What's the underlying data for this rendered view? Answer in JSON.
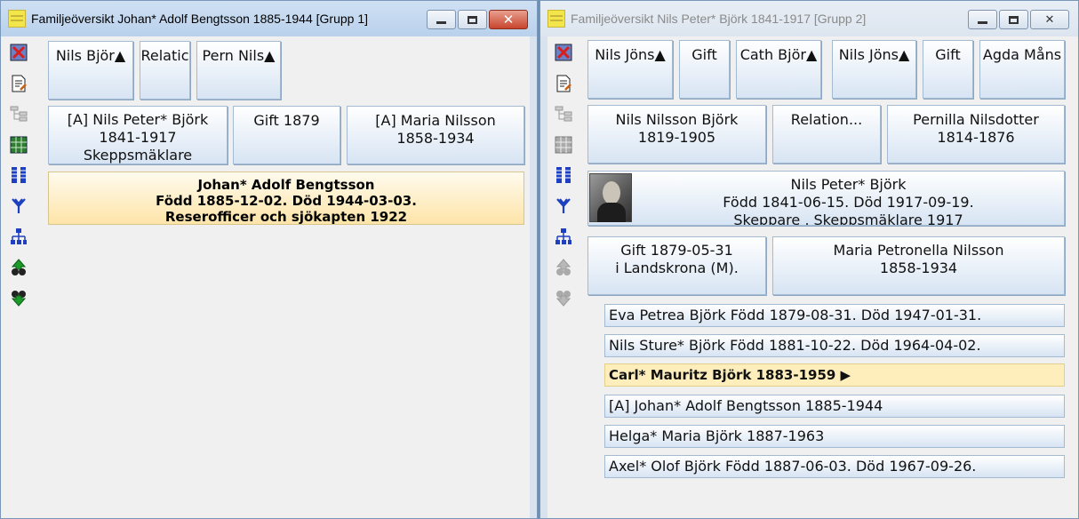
{
  "window1": {
    "title": "Familjeöversikt Johan* Adolf Bengtsson 1885-1944 [Grupp 1]",
    "grandparents": [
      "Nils Björ▲",
      "Relatic",
      "Pern Nils▲"
    ],
    "father": [
      "[A] Nils Peter* Björk",
      "1841-1917",
      "Skeppsmäklare"
    ],
    "marriage": "Gift 1879",
    "mother": [
      "[A] Maria Nilsson",
      "1858-1934"
    ],
    "person": [
      "Johan* Adolf Bengtsson",
      "Född 1885-12-02. Död 1944-03-03.",
      "Reserofficer och sjökapten 1922"
    ]
  },
  "window2": {
    "title": "Familjeöversikt Nils Peter* Björk 1841-1917 [Grupp 2]",
    "grandparents": [
      "Nils Jöns▲",
      "Gift",
      "Cath Björ▲",
      "Nils Jöns▲",
      "Gift",
      "Agda Måns"
    ],
    "father": [
      "Nils Nilsson Björk",
      "1819-1905"
    ],
    "relation": "Relation...",
    "mother": [
      "Pernilla Nilsdotter",
      "1814-1876"
    ],
    "person": [
      "Nils Peter* Björk",
      "Född 1841-06-15. Död 1917-09-19.",
      "Skeppare , Skeppsmäklare 1917"
    ],
    "marriage": [
      "Gift 1879-05-31",
      "i  Landskrona (M)."
    ],
    "spouse": [
      "Maria Petronella Nilsson",
      "1858-1934"
    ],
    "children": [
      "Eva Petrea Björk Född 1879-08-31. Död 1947-01-31.",
      "Nils Sture* Björk Född 1881-10-22. Död 1964-04-02.",
      "Carl* Mauritz Björk 1883-1959 ▶",
      "[A] Johan* Adolf Bengtsson 1885-1944",
      "Helga* Maria Björk 1887-1963",
      "Axel* Olof Björk Född 1887-06-03. Död 1967-09-26."
    ]
  },
  "toolbar_icons": [
    "close-x-icon",
    "document-edit-icon",
    "tree-list-icon",
    "group-sheet-icon",
    "columns-icon",
    "fork-tree-icon",
    "org-chart-icon",
    "up-arrow-binoculars-icon",
    "down-arrow-binoculars-icon"
  ],
  "colors": {
    "selected_row": "#fdeebb",
    "box_gradient_top": "#ffffff",
    "box_gradient_bottom": "#d7e4f3",
    "close_button": "#c8452d"
  }
}
